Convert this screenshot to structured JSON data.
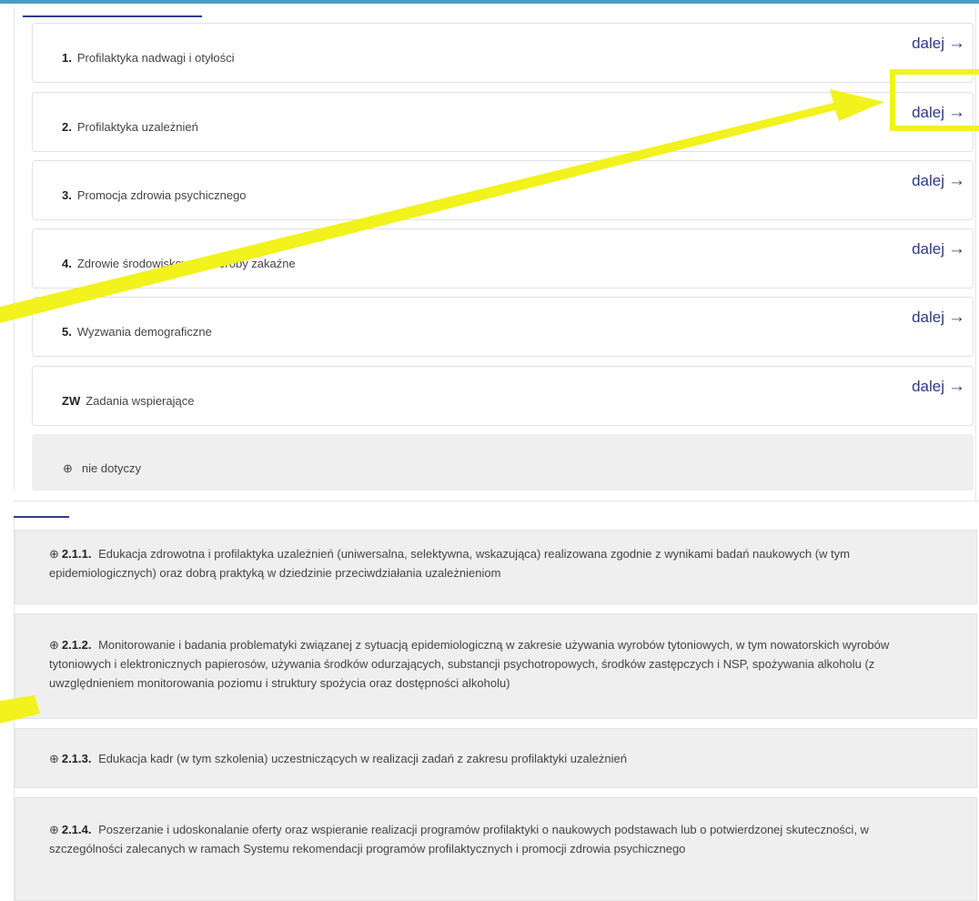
{
  "categories": [
    {
      "num": "1.",
      "label": "Profilaktyka nadwagi i otyłości",
      "action": "dalej",
      "arrow": "→"
    },
    {
      "num": "2.",
      "label": "Profilaktyka uzależnień",
      "action": "dalej",
      "arrow": "→"
    },
    {
      "num": "3.",
      "label": "Promocja zdrowia psychicznego",
      "action": "dalej",
      "arrow": "→"
    },
    {
      "num": "4.",
      "label": "Zdrowie środowiskowe i choroby zakaźne",
      "action": "dalej",
      "arrow": "→"
    },
    {
      "num": "5.",
      "label": "Wyzwania demograficzne",
      "action": "dalej",
      "arrow": "→"
    },
    {
      "num": "ZW",
      "label": "Zadania wspierające",
      "action": "dalej",
      "arrow": "→"
    }
  ],
  "not_applicable": {
    "icon": "target-icon",
    "glyph": "⊕",
    "label": "nie dotyczy"
  },
  "tasks": [
    {
      "code": "2.1.1.",
      "glyph": "⊕",
      "text": "Edukacja zdrowotna i profilaktyka uzależnień (uniwersalna, selektywna, wskazująca) realizowana zgodnie z wynikami badań naukowych (w tym epidemiologicznych) oraz dobrą praktyką w dziedzinie przeciwdziałania uzależnieniom"
    },
    {
      "code": "2.1.2.",
      "glyph": "⊕",
      "text": "Monitorowanie i badania problematyki związanej z sytuacją epidemiologiczną w zakresie używania wyrobów tytoniowych, w tym nowatorskich wyrobów tytoniowych i elektronicznych papierosów, używania środków odurzających, substancji psychotropowych, środków zastępczych i NSP, spożywania alkoholu (z uwzględnieniem monitorowania poziomu i struktury spożycia oraz dostępności alkoholu)"
    },
    {
      "code": "2.1.3.",
      "glyph": "⊕",
      "text": "Edukacja kadr (w tym szkolenia) uczestniczących w realizacji zadań z zakresu profilaktyki uzależnień"
    },
    {
      "code": "2.1.4.",
      "glyph": "⊕",
      "text": "Poszerzanie i udoskonalanie oferty oraz wspieranie realizacji programów profilaktyki o naukowych podstawach lub o potwierdzonej skuteczności, w szczególności zalecanych w ramach Systemu rekomendacji programów profilaktycznych i promocji zdrowia psychicznego"
    }
  ],
  "colors": {
    "accent": "#2f3d8f",
    "link": "#2c3a8a",
    "top_border": "#4a9cc6",
    "highlight": "#f2f21c",
    "gray_card": "#efefef"
  }
}
